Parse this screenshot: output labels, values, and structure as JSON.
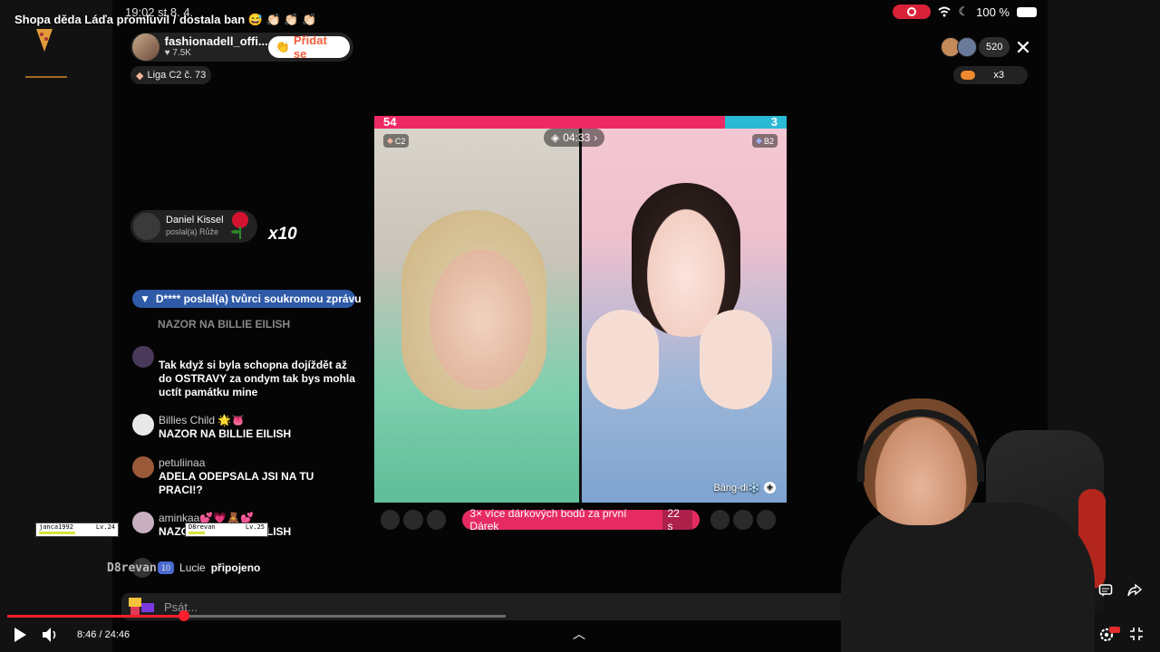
{
  "video": {
    "title": "Shopa děda Láďa promluvil / dostala ban 😅 👏🏻 👏🏻 👏🏻",
    "current_time": "8:46",
    "duration": "24:46",
    "time_display": "8:46 / 24:46",
    "progress": 0.354
  },
  "statusbar": {
    "time": "19:02   st 8. 4.",
    "battery": "100 %"
  },
  "live": {
    "host_name": "fashionadell_offi...",
    "host_likes": "7.5K",
    "follow_label": "Přidat se",
    "league": "Liga C2 č. 73",
    "viewer_count": "520",
    "gift_multiplier": "x3"
  },
  "battle": {
    "score_left": "54",
    "score_right": "3",
    "score_left_share": 0.85,
    "timer": "04:33",
    "tier_left": "C2",
    "tier_right": "B2",
    "opponent_name": "Bāng-di❄️"
  },
  "boost": {
    "text": "3× více dárkových bodů za první Dárek",
    "seconds": "22 s"
  },
  "gift": {
    "sender": "Daniel Kissel",
    "action": "poslal(a) Růže",
    "count": "x10"
  },
  "dm_notice": "D**** poslal(a) tvůrci soukromou zprávu",
  "chat": {
    "faded": "NAZOR NA BILLIE EILISH",
    "messages": [
      {
        "user": "",
        "text": "Tak když si byla schopna dojíždět až do OSTRAVY  za ondym tak bys mohla uctít památku mine"
      },
      {
        "user": "Billies Child 🌟👅",
        "text": "NAZOR NA BILLIE EILISH"
      },
      {
        "user": "petuliinaa",
        "text": "ADELA ODEPSALA JSI NA TU PRACI!?"
      },
      {
        "user": "aminkaa💕💗🧸💕",
        "text": "NAZOR NA BILLIE EILISH"
      }
    ],
    "joined_user": "Lucie",
    "joined_text": "připojeno",
    "joined_badge": "10",
    "input_placeholder": "Psát..."
  },
  "overlay": {
    "card1_name": "janca1992",
    "card1_level": "Lv.24",
    "card2_name": "D8revan",
    "card2_level": "Lv.25",
    "name": "D8revan"
  },
  "colors": {
    "score_left": "#ee2a66",
    "score_right": "#2bb9d6",
    "progress": "#ff1f2f",
    "dm_notice": "#2e5aa8",
    "boost": "#e62b63"
  },
  "icons": [
    "close-icon",
    "play-icon",
    "volume-icon",
    "settings-icon",
    "fullscreen-exit-icon",
    "chat-icon",
    "share-icon",
    "diamond-icon",
    "rose-icon",
    "filter-icon",
    "chevron-up-icon"
  ]
}
